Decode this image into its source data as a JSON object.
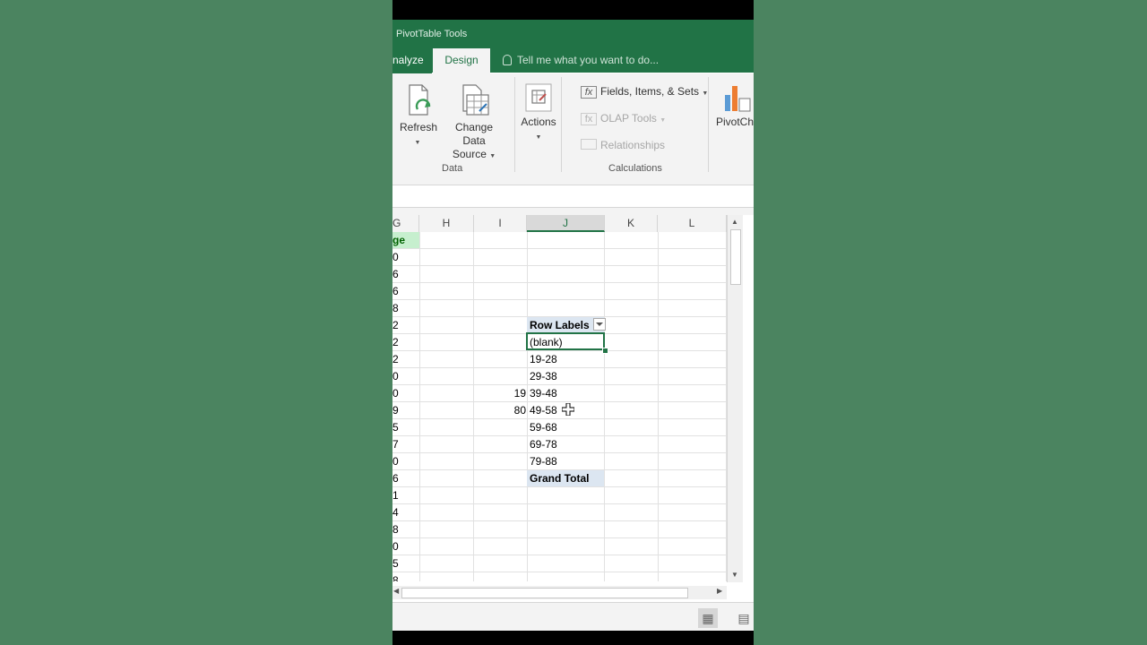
{
  "ribbon": {
    "context_label": "PivotTable Tools",
    "tabs": [
      {
        "label": "nalyze",
        "active": false
      },
      {
        "label": "Design",
        "active": true
      }
    ],
    "tell_me": "Tell me what you want to do...",
    "buttons": {
      "refresh": "Refresh",
      "change_data_source_line1": "Change Data",
      "change_data_source_line2": "Source",
      "actions": "Actions",
      "fields_items_sets": "Fields, Items, & Sets",
      "olap_tools": "OLAP Tools",
      "relationships": "Relationships",
      "pivotchart": "PivotCh"
    },
    "groups": {
      "data": "Data",
      "calculations": "Calculations"
    }
  },
  "sheet": {
    "columns": [
      "G",
      "H",
      "I",
      "J",
      "K",
      "L"
    ],
    "selected_column": "J",
    "g_header": "ge",
    "rows": [
      {
        "g": "0",
        "i": "",
        "j": ""
      },
      {
        "g": "6",
        "i": "",
        "j": ""
      },
      {
        "g": "6",
        "i": "",
        "j": ""
      },
      {
        "g": "8",
        "i": "",
        "j": ""
      },
      {
        "g": "2",
        "i": "",
        "j": "Row Labels"
      },
      {
        "g": "2",
        "i": "",
        "j": "(blank)"
      },
      {
        "g": "2",
        "i": "",
        "j": "19-28"
      },
      {
        "g": "0",
        "i": "",
        "j": "29-38"
      },
      {
        "g": "0",
        "i": "19",
        "j": "39-48"
      },
      {
        "g": "9",
        "i": "80",
        "j": "49-58"
      },
      {
        "g": "5",
        "i": "",
        "j": "59-68"
      },
      {
        "g": "7",
        "i": "",
        "j": "69-78"
      },
      {
        "g": "0",
        "i": "",
        "j": "79-88"
      },
      {
        "g": "6",
        "i": "",
        "j": "Grand Total"
      },
      {
        "g": "1",
        "i": "",
        "j": ""
      },
      {
        "g": "4",
        "i": "",
        "j": ""
      },
      {
        "g": "8",
        "i": "",
        "j": ""
      },
      {
        "g": "0",
        "i": "",
        "j": ""
      },
      {
        "g": "5",
        "i": "",
        "j": ""
      },
      {
        "g": "8",
        "i": "",
        "j": ""
      }
    ]
  },
  "colors": {
    "excel_green": "#217346",
    "background": "#4b8460",
    "pivot_header_fill": "#dce6f1"
  }
}
